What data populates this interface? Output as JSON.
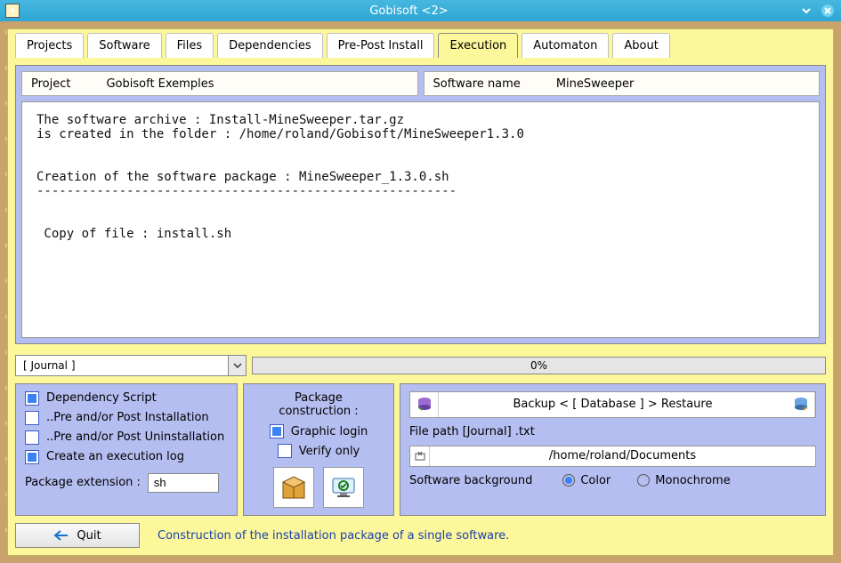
{
  "window": {
    "title": "Gobisoft <2>"
  },
  "tabs": [
    "Projects",
    "Software",
    "Files",
    "Dependencies",
    "Pre-Post Install",
    "Execution",
    "Automaton",
    "About"
  ],
  "active_tab_index": 5,
  "header": {
    "project_label": "Project",
    "project_value": "Gobisoft Exemples",
    "software_label": "Software name",
    "software_value": "MineSweeper"
  },
  "log_text": "The software archive : Install-MineSweeper.tar.gz\nis created in the folder : /home/roland/Gobisoft/MineSweeper1.3.0\n\n\nCreation of the software package : MineSweeper_1.3.0.sh\n--------------------------------------------------------\n\n\n Copy of file : install.sh",
  "journal_combo": "[ Journal ]",
  "progress_text": "0%",
  "left": {
    "dep_script": "Dependency Script",
    "pre_post_install": "..Pre and/or Post Installation",
    "pre_post_uninstall": "..Pre and/or Post Uninstallation",
    "exec_log": "Create an execution log",
    "ext_label": "Package extension :",
    "ext_value": "sh"
  },
  "mid": {
    "title": "Package\nconstruction :",
    "graphic_login": "Graphic login",
    "verify_only": "Verify only"
  },
  "right": {
    "backup_text": "Backup  < [ Database ] >  Restaure",
    "filepath_label": "File path [Journal] .txt",
    "filepath_value": "/home/roland/Documents",
    "bg_label": "Software background",
    "color": "Color",
    "mono": "Monochrome"
  },
  "footer": {
    "quit": "Quit",
    "status": "Construction of the installation package of a single software."
  }
}
